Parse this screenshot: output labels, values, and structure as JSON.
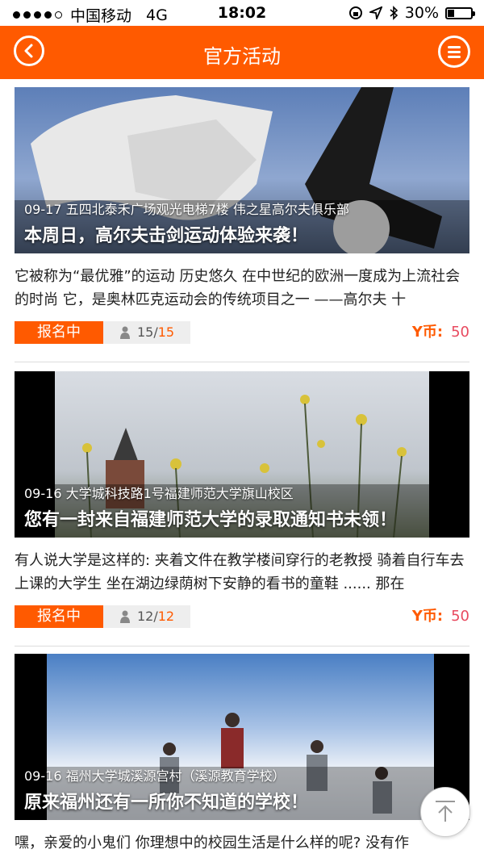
{
  "status_bar": {
    "carrier": "中国移动",
    "network": "4G",
    "time": "18:02",
    "battery": "30%",
    "battery_level": 0.3
  },
  "nav": {
    "title": "官方活动"
  },
  "colors": {
    "accent": "#ff5a00",
    "coin_value": "#e84a5f"
  },
  "activities": [
    {
      "meta": "09-17 五四北泰禾广场观光电梯7楼 伟之星高尔夫俱乐部",
      "headline": "本周日，高尔夫击剑运动体验来袭！",
      "description": "它被称为“最优雅”的运动 历史悠久 在中世纪的欧洲一度成为上流社会的时尚 它，是奥林匹克运动会的传统项目之一 ——高尔夫 十",
      "status": "报名中",
      "count_current": "15",
      "count_separator": "/",
      "count_max": "15",
      "coin_label": "Y币:",
      "coin_value": "50"
    },
    {
      "meta": "09-16 大学城科技路1号福建师范大学旗山校区",
      "headline": "您有一封来自福建师范大学的录取通知书未领！",
      "description": "有人说大学是这样的: 夹着文件在教学楼间穿行的老教授 骑着自行车去上课的大学生 坐在湖边绿荫树下安静的看书的童鞋 ...... 那在",
      "status": "报名中",
      "count_current": "12",
      "count_separator": "/",
      "count_max": "12",
      "coin_label": "Y币:",
      "coin_value": "50"
    },
    {
      "meta": "09-16 福州大学城溪源宫村（溪源教育学校）",
      "headline": "原来福州还有一所你不知道的学校！",
      "description": "嘿，亲爱的小鬼们 你理想中的校园生活是什么样的呢? 没有作"
    }
  ]
}
